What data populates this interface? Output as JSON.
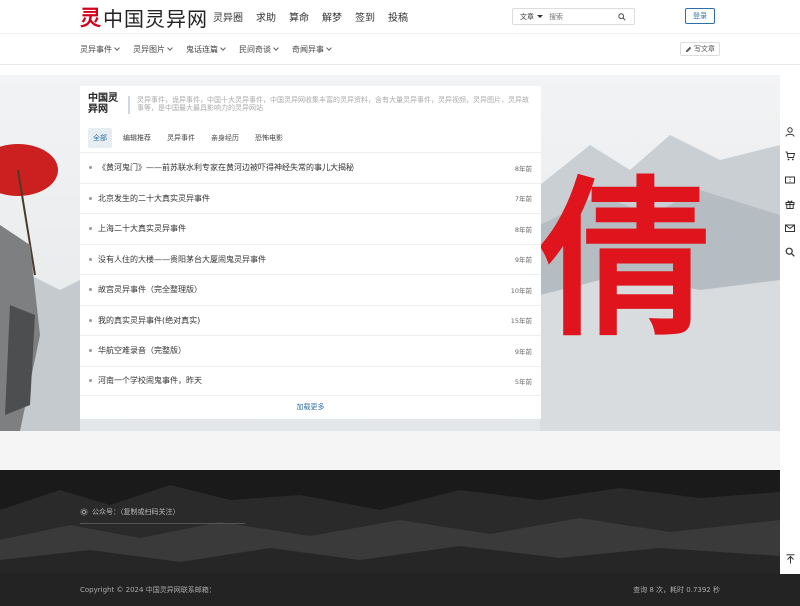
{
  "header": {
    "logo_mark": "灵",
    "logo_text": "中国灵异网",
    "nav": [
      "灵异圈",
      "求助",
      "算命",
      "解梦",
      "签到",
      "投稿"
    ],
    "search": {
      "type_label": "文章",
      "placeholder": "搜索"
    },
    "login_label": "登录"
  },
  "subnav": {
    "items": [
      "灵异事件",
      "灵异图片",
      "鬼话连篇",
      "民间奇谈",
      "奇闻异事"
    ],
    "write_label": "写文章"
  },
  "hero": {
    "big_char": "倩"
  },
  "card": {
    "title": "中国灵异网",
    "description": "灵异事件，诡异事件，中国十大灵异事件，中国灵异网收集丰富的灵异资料，含有大量灵异事件，灵异视频，灵异图片，灵异故事等，是中国最大最具影响力的灵异网站",
    "tabs": [
      "全部",
      "编辑推荐",
      "灵异事件",
      "亲身经历",
      "恐怖电影"
    ],
    "active_tab": "全部",
    "items": [
      {
        "title": "《黄河鬼门》——前苏联水利专家在黄河边被吓得神经失常的事儿大揭秘",
        "time": "8年前"
      },
      {
        "title": "北京发生的二十大真实灵异事件",
        "time": "7年前"
      },
      {
        "title": "上海二十大真实灵异事件",
        "time": "8年前"
      },
      {
        "title": "没有人住的大楼——贵阳茅台大厦闹鬼灵异事件",
        "time": "9年前"
      },
      {
        "title": "故宫灵异事件（完全整理版）",
        "time": "10年前"
      },
      {
        "title": "我的真实灵异事件(绝对真实)",
        "time": "15年前"
      },
      {
        "title": "华航空难录音（完整版）",
        "time": "9年前"
      },
      {
        "title": "河南一个学校闹鬼事件，昨天",
        "time": "5年前"
      }
    ],
    "load_more": "加载更多"
  },
  "sidebar": {
    "icons": [
      "user-icon",
      "cart-icon",
      "ticket-icon",
      "gift-icon",
      "mail-icon",
      "search-icon"
    ]
  },
  "footer": {
    "wechat": "公众号：（复制或扫码关注）",
    "copyright": "Copyright © 2024 中国灵异网联系邮箱：",
    "stats": "查询 8 次，耗时 0.7392 秒"
  },
  "colors": {
    "accent": "#2e6ea8",
    "brand_red": "#e0141c"
  }
}
